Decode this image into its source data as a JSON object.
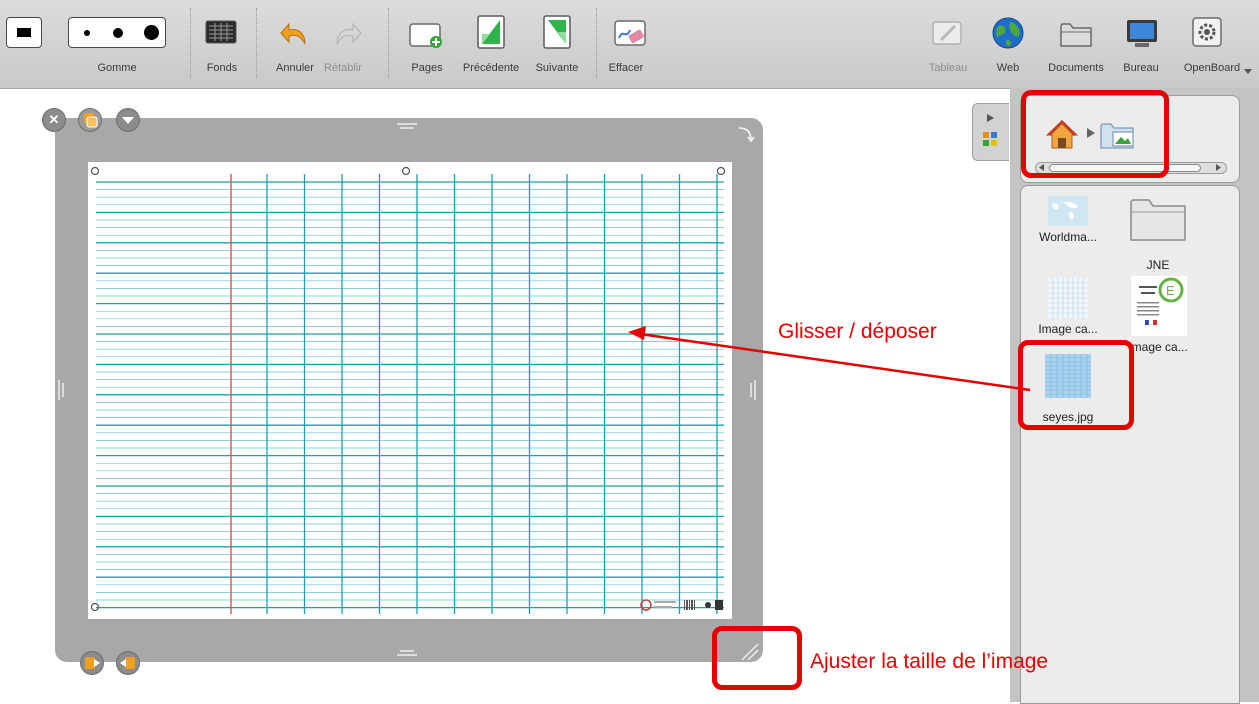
{
  "toolbar": {
    "eraser_label": "Gomme",
    "backgrounds_label": "Fonds",
    "undo_label": "Annuler",
    "redo_label": "Rétablir",
    "pages_label": "Pages",
    "previous_label": "Précédente",
    "next_label": "Suivante",
    "clear_label": "Effacer",
    "board_label": "Tableau",
    "web_label": "Web",
    "documents_label": "Documents",
    "desktop_label": "Bureau",
    "openboard_label": "OpenBoard"
  },
  "library": {
    "items": [
      {
        "label": "Worldma...",
        "icon": "world-map-thumbnail"
      },
      {
        "label": "JNE",
        "icon": "folder-icon"
      },
      {
        "label": "Image ca...",
        "icon": "grid-paper-thumbnail"
      },
      {
        "label": "Image ca...",
        "icon": "document-logo-thumbnail"
      },
      {
        "label": "seyes.jpg",
        "icon": "seyes-thumbnail"
      }
    ]
  },
  "annotations": {
    "drag_drop": "Glisser / déposer",
    "resize": "Ajuster la taille de l’image"
  },
  "colors": {
    "accent_red": "#e60000",
    "grid_blue": "#1aa0b0",
    "margin_red": "#e05050",
    "toolbar_bg": "#d2d2d2"
  }
}
